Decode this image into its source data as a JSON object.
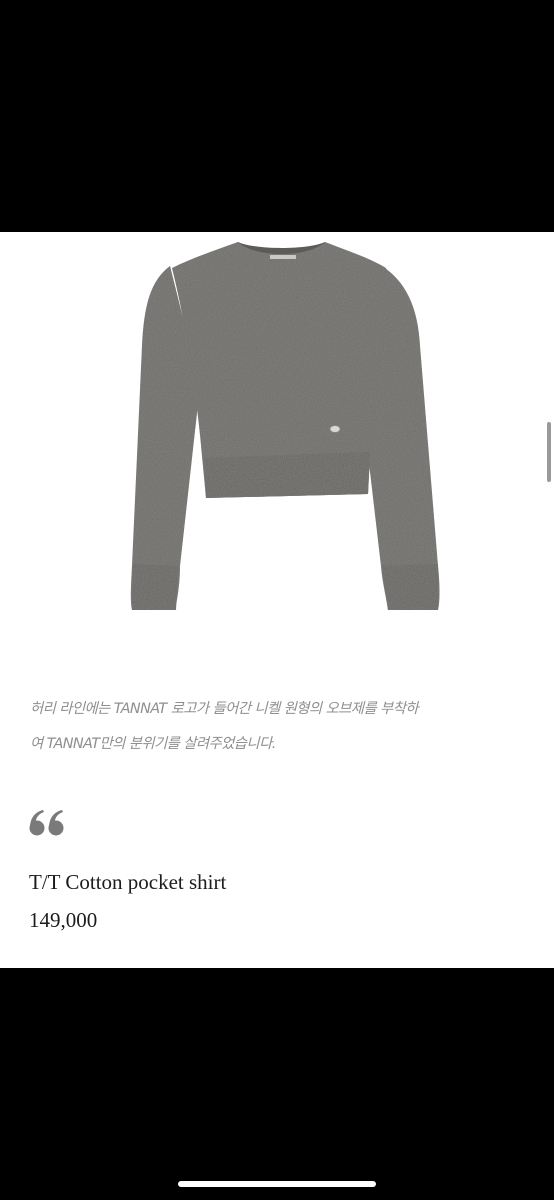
{
  "product": {
    "image_icon": "grey-cropped-knit-sweater",
    "description_line1": "허리 라인에는 TANNAT 로고가 들어간 니켈 원형의 오브제를 부착하",
    "description_line2": "여 TANNAT만의 분위기를 살려주었습니다.",
    "quote_icon": "double-quote-icon",
    "name": "T/T Cotton pocket shirt",
    "price": "149,000"
  },
  "colors": {
    "background": "#000000",
    "card": "#ffffff",
    "description_text": "#8f8f8f",
    "quote_mark": "#7a7a7a",
    "title_text": "#1c1c1c",
    "sweater": "#6d6b67"
  }
}
